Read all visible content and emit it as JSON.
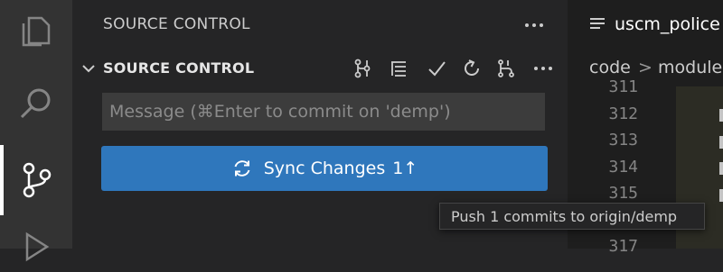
{
  "sidebar": {
    "header_title": "SOURCE CONTROL",
    "section_title": "SOURCE CONTROL",
    "commit_placeholder": "Message (⌘Enter to commit on 'demp')",
    "commit_value": "",
    "sync_button_label": "Sync Changes",
    "sync_count": "1",
    "sync_arrow": "↑"
  },
  "editor": {
    "tab_label": "uscm_police",
    "breadcrumb": [
      "code",
      ">",
      "module"
    ],
    "line_numbers": [
      "311",
      "312",
      "313",
      "314",
      "315",
      "316",
      "317"
    ]
  },
  "tooltip": {
    "text": "Push 1 commits to origin/demp"
  },
  "icons": {
    "activity": [
      "explorer-icon",
      "search-icon",
      "source-control-icon",
      "run-debug-icon"
    ],
    "toolbar": [
      "graph-icon",
      "list-view-icon",
      "checkmark-icon",
      "refresh-icon",
      "branch-icon",
      "more-icon"
    ]
  },
  "colors": {
    "sync_button": "#2f77bc",
    "activity_bar": "#333333",
    "sidebar": "#252526",
    "editor": "#1e1e1e"
  }
}
